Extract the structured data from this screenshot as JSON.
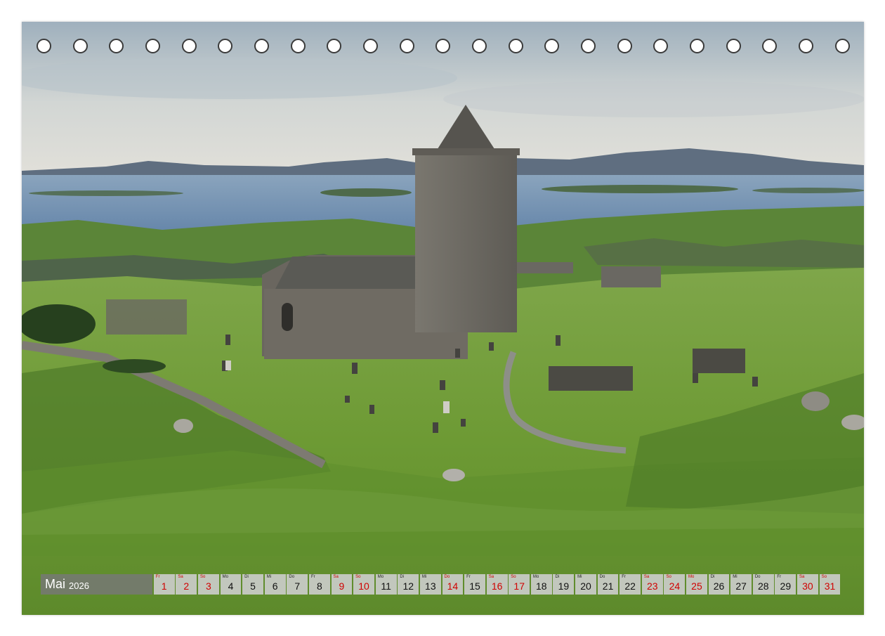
{
  "calendar": {
    "month": "Mai",
    "year": "2026",
    "days": [
      {
        "abbr": "Fr",
        "num": "1",
        "red": true
      },
      {
        "abbr": "Sa",
        "num": "2",
        "red": true
      },
      {
        "abbr": "So",
        "num": "3",
        "red": true
      },
      {
        "abbr": "Mo",
        "num": "4",
        "red": false
      },
      {
        "abbr": "Di",
        "num": "5",
        "red": false
      },
      {
        "abbr": "Mi",
        "num": "6",
        "red": false
      },
      {
        "abbr": "Do",
        "num": "7",
        "red": false
      },
      {
        "abbr": "Fr",
        "num": "8",
        "red": false
      },
      {
        "abbr": "Sa",
        "num": "9",
        "red": true
      },
      {
        "abbr": "So",
        "num": "10",
        "red": true
      },
      {
        "abbr": "Mo",
        "num": "11",
        "red": false
      },
      {
        "abbr": "Di",
        "num": "12",
        "red": false
      },
      {
        "abbr": "Mi",
        "num": "13",
        "red": false
      },
      {
        "abbr": "Do",
        "num": "14",
        "red": true
      },
      {
        "abbr": "Fr",
        "num": "15",
        "red": false
      },
      {
        "abbr": "Sa",
        "num": "16",
        "red": true
      },
      {
        "abbr": "So",
        "num": "17",
        "red": true
      },
      {
        "abbr": "Mo",
        "num": "18",
        "red": false
      },
      {
        "abbr": "Di",
        "num": "19",
        "red": false
      },
      {
        "abbr": "Mi",
        "num": "20",
        "red": false
      },
      {
        "abbr": "Do",
        "num": "21",
        "red": false
      },
      {
        "abbr": "Fr",
        "num": "22",
        "red": false
      },
      {
        "abbr": "Sa",
        "num": "23",
        "red": true
      },
      {
        "abbr": "So",
        "num": "24",
        "red": true
      },
      {
        "abbr": "Mo",
        "num": "25",
        "red": true
      },
      {
        "abbr": "Di",
        "num": "26",
        "red": false
      },
      {
        "abbr": "Mi",
        "num": "27",
        "red": false
      },
      {
        "abbr": "Do",
        "num": "28",
        "red": false
      },
      {
        "abbr": "Fr",
        "num": "29",
        "red": false
      },
      {
        "abbr": "Sa",
        "num": "30",
        "red": true
      },
      {
        "abbr": "So",
        "num": "31",
        "red": true
      }
    ]
  },
  "binding_holes": 23,
  "colors": {
    "holiday_red": "#d00000",
    "sky": "#c9d2d8",
    "sea": "#6f8fb0",
    "grass": "#6f9a3a",
    "stone": "#6e6a62"
  }
}
